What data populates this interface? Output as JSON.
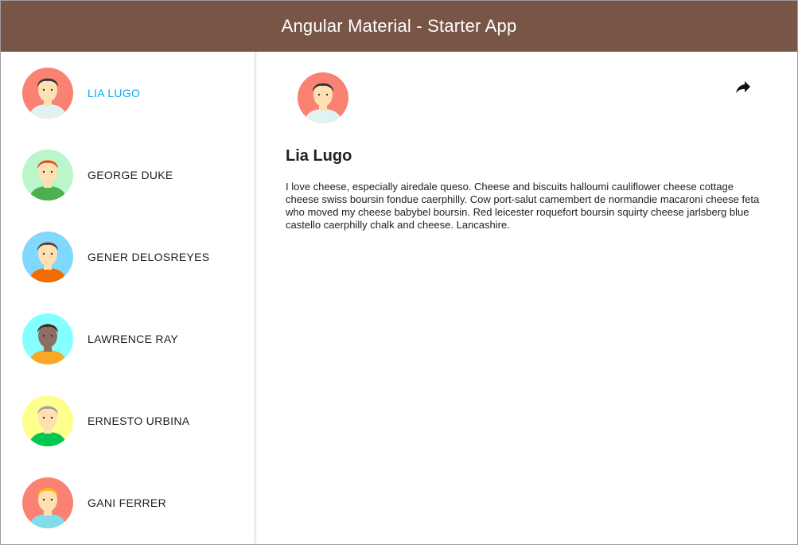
{
  "toolbar": {
    "title": "Angular Material - Starter App",
    "color": "#795548"
  },
  "users": [
    {
      "name": "Lia Lugo",
      "bg": "#f98273",
      "hair": "#333333",
      "shirt": "#e0f2f1",
      "skin": "#ffe0b2",
      "selected": true
    },
    {
      "name": "George Duke",
      "bg": "#b9f6ca",
      "hair": "#e64a19",
      "shirt": "#4caf50",
      "skin": "#ffe0b2",
      "selected": false
    },
    {
      "name": "Gener Delosreyes",
      "bg": "#80d8ff",
      "hair": "#5d4037",
      "shirt": "#ef6c00",
      "skin": "#ffe0b2",
      "selected": false
    },
    {
      "name": "Lawrence Ray",
      "bg": "#84ffff",
      "hair": "#3e2723",
      "shirt": "#f9a825",
      "skin": "#8d6e63",
      "selected": false
    },
    {
      "name": "Ernesto Urbina",
      "bg": "#ffff8d",
      "hair": "#9e9e9e",
      "shirt": "#00c853",
      "skin": "#ffe0b2",
      "selected": false
    },
    {
      "name": "Gani Ferrer",
      "bg": "#f98273",
      "hair": "#ffb300",
      "shirt": "#80deea",
      "skin": "#ffe0b2",
      "selected": false
    }
  ],
  "detail": {
    "name": "Lia Lugo",
    "bio": "I love cheese, especially airedale queso. Cheese and biscuits halloumi cauliflower cheese cottage cheese swiss boursin fondue caerphilly. Cow port-salut camembert de normandie macaroni cheese feta who moved my cheese babybel boursin. Red leicester roquefort boursin squirty cheese jarlsberg blue castello caerphilly chalk and cheese. Lancashire.",
    "share_icon": "share-icon"
  },
  "accent": "#03a9f4"
}
